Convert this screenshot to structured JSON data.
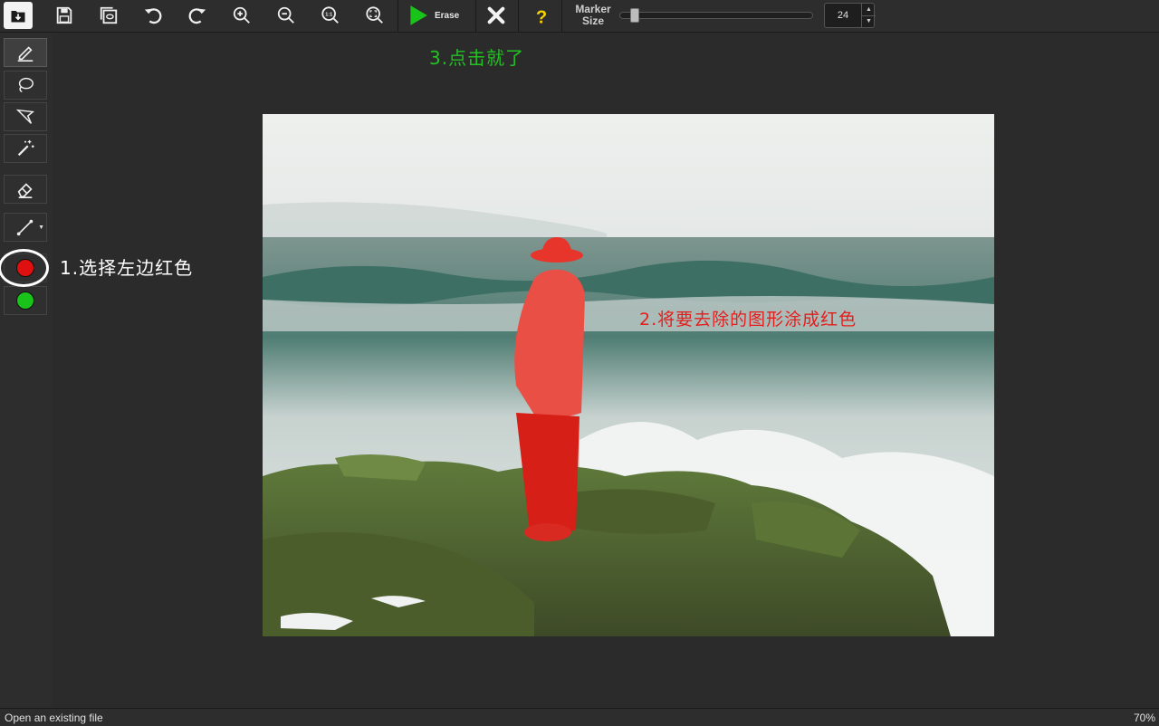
{
  "toolbar": {
    "erase_label": "Erase",
    "marker_size_label_line1": "Marker",
    "marker_size_label_line2": "Size",
    "marker_size_value": "24",
    "marker_size_fraction": 0.06,
    "icons": [
      "open-file-icon",
      "save-icon",
      "save-as-icon",
      "undo-icon",
      "redo-icon",
      "zoom-in-icon",
      "zoom-out-icon",
      "actual-size-icon",
      "fit-to-window-icon",
      "play-icon",
      "close-icon",
      "help-icon"
    ]
  },
  "tools": {
    "items": [
      "pencil-marker",
      "lasso",
      "polygon-lasso",
      "magic-wand",
      "eraser",
      "line",
      "red-color",
      "green-color"
    ],
    "red_color": "#e01010",
    "green_color": "#19c319",
    "selected": "pencil-marker"
  },
  "annotations": {
    "step1": "1.选择左边红色",
    "step2": "2.将要去除的图形涂成红色",
    "step3": "3.点击就了"
  },
  "status": {
    "message": "Open an existing file",
    "zoom": "70%"
  },
  "colors": {
    "accent_green": "#23c123",
    "accent_red": "#e51d1d",
    "help_yellow": "#f5d200",
    "mask_red": "#e8352c"
  }
}
